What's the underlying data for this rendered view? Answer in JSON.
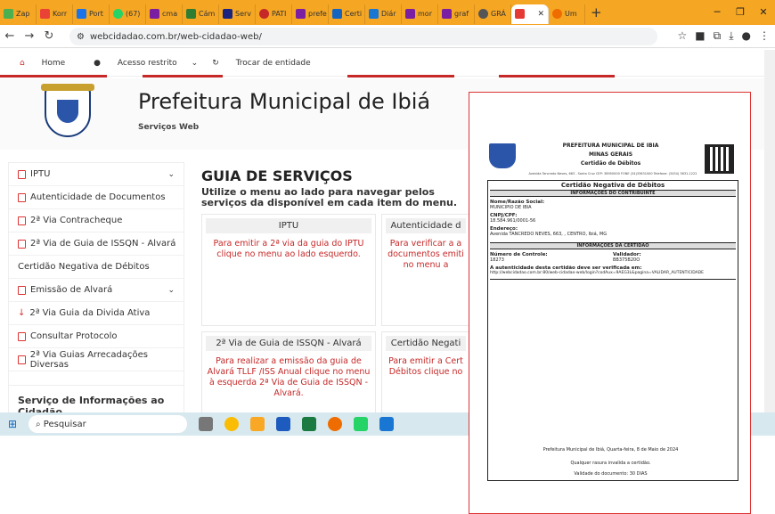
{
  "browser": {
    "tabs": [
      "Zap",
      "Korr",
      "Port",
      "(67)",
      "cma",
      "Cám",
      "Serv",
      "PATI",
      "prefe",
      "Certi",
      "Diár",
      "mor",
      "graf",
      "GRÁ",
      "Um"
    ],
    "url": "webcidadao.com.br/web-cidadao-web/"
  },
  "sitenav": {
    "home": "Home",
    "acesso": "Acesso restrito",
    "trocar": "Trocar de entidade"
  },
  "header": {
    "title": "Prefeitura Municipal de Ibiá",
    "subtitle": "Serviços Web"
  },
  "sidebar": {
    "items": [
      "IPTU",
      "Autenticidade de Documentos",
      "2ª Via Contracheque",
      "2ª Via de Guia de ISSQN - Alvará",
      "Certidão Negativa de Débitos",
      "Emissão de Alvará",
      "2ª Via Guia da Divida Ativa",
      "Consultar Protocolo",
      "2ª Via Guias Arrecadações Diversas"
    ],
    "section2": "Serviço de Informações ao Cidadão"
  },
  "main": {
    "title": "GUIA DE SERVIÇOS",
    "desc": "Utilize o menu ao lado para navegar pelos serviços da disponível em cada item do menu.",
    "cards": [
      {
        "h": "IPTU",
        "b": "Para emitir a 2ª via da guia do IPTU clique no menu ao lado esquerdo."
      },
      {
        "h": "Autenticidade d",
        "b": "Para verificar a a documentos emiti no menu a"
      },
      {
        "h": "2ª Via de Guia de ISSQN - Alvará",
        "b": "Para realizar a emissão da guia de Alvará TLLF /ISS Anual clique no menu à esquerda 2ª Via de Guia de ISSQN - Alvará."
      },
      {
        "h": "Certidão Negati",
        "b": "Para emitir a Cert Débitos clique no"
      }
    ]
  },
  "taskbar": {
    "search": "Pesquisar"
  },
  "certificate": {
    "org": "PREFEITURA MUNICIPAL DE IBIA",
    "state": "MINAS GERAIS",
    "doc": "Certidão de Débitos",
    "address": "Avenida Tancredo Neves, 663 - Santa Cruz CEP: 38950000 FONE (34)33631000 Telefone: (3434) 3631-1222",
    "title": "Certidão Negativa de Débitos",
    "sec1": "INFORMAÇÕES DO CONTRIBUINTE",
    "nome_l": "Nome/Razão Social:",
    "nome": "MUNICIPIO DE IBIA",
    "cnpj_l": "CNPJ/CPF:",
    "cnpj": "18.584.961/0001-56",
    "end_l": "Endereço:",
    "end": "Avenida TANCREDO NEVES, 663, , CENTRO, Ibiá, MG",
    "sec2": "INFORMAÇÕES DA CERTIDÃO",
    "ctrl_l": "Número de Controle:",
    "ctrl": "18273",
    "valid_l": "Validador:",
    "valid": "BB375B20O",
    "auth_l": "A autenticidade desta certidão deve ser verificada em:",
    "auth": "http://webcidadao.com.br:80/web-cidadao-web/login?codAux=9AEG3L&pagina=VALIDAR_AUTENTICIDADE",
    "foot1": "Prefeitura Municipal de Ibiá, Quarta-feira, 8 de Maio de 2024",
    "foot2": "Qualquer rasura invalida a certidão.",
    "foot3": "Validade do documento: 30 DIAS"
  }
}
